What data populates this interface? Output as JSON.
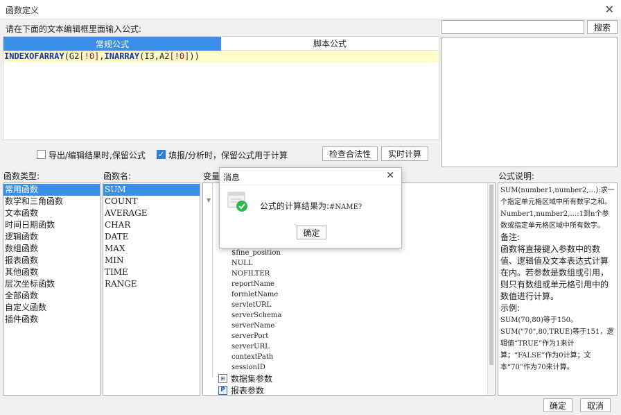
{
  "window": {
    "title": "函数定义",
    "close": "✕"
  },
  "editor": {
    "prompt": "请在下面的文本编辑框里面输入公式:",
    "tabs": [
      "常规公式",
      "脚本公式"
    ],
    "formula_tokens": [
      {
        "t": "INDEXOFARRAY",
        "c": "fn"
      },
      {
        "t": "(G2",
        "c": ""
      },
      {
        "t": "[!0]",
        "c": "br"
      },
      {
        "t": ",",
        "c": ""
      },
      {
        "t": "INARRAY",
        "c": "fn"
      },
      {
        "t": "(I3,A2",
        "c": ""
      },
      {
        "t": "[!0]",
        "c": "br"
      },
      {
        "t": "))",
        "c": ""
      }
    ]
  },
  "search": {
    "value": "",
    "button": "搜索"
  },
  "options": {
    "keep_export": {
      "label": "导出/编辑结果时,保留公式",
      "checked": false
    },
    "keep_fill": {
      "label": "填报/分析时，保留公式用于计算",
      "checked": true
    },
    "check_button": "检查合法性",
    "realtime_button": "实时计算"
  },
  "function_types": {
    "header": "函数类型:",
    "items": [
      "常用函数",
      "数学和三角函数",
      "文本函数",
      "时间日期函数",
      "逻辑函数",
      "数组函数",
      "报表函数",
      "其他函数",
      "层次坐标函数",
      "全部函数",
      "自定义函数",
      "插件函数"
    ],
    "selected": 0
  },
  "function_names": {
    "header": "函数名:",
    "items": [
      "SUM",
      "COUNT",
      "AVERAGE",
      "CHAR",
      "DATE",
      "MAX",
      "MIN",
      "TIME",
      "RANGE"
    ],
    "selected": 0
  },
  "variables": {
    "header": "变量",
    "items": [
      "$fine_position",
      "NULL",
      "NOFILTER",
      "reportName",
      "formletName",
      "servletURL",
      "serverSchema",
      "serverName",
      "serverPort",
      "serverURL",
      "contextPath",
      "sessionID"
    ],
    "group_dataset": "数据集参数",
    "group_report": "报表参数"
  },
  "description": {
    "header": "公式说明:",
    "lines": [
      {
        "t": "SUM(number1,number2,…):求一个指定单元格区域中所有数字之和。",
        "s": true
      },
      {
        "t": "Number1,number2,…:1到n个参数或指定单元格区域中所有数字。",
        "s": true
      },
      {
        "t": "备注:",
        "s": false
      },
      {
        "t": "函数将直接键入参数中的数值、逻辑值及文本表达式计算在内。若参数是数组或引用，则只有数组或单元格引用中的数值进行计算。",
        "s": false
      },
      {
        "t": "示例:",
        "s": false
      },
      {
        "t": "SUM(70,80)等于150。",
        "s": true
      },
      {
        "t": "SUM(\"70\",80,TRUE)等于151，逻辑值“TRUE”作为1来计算；“FALSE”作为0计算；文本“70”作为70来计算。",
        "s": true
      }
    ]
  },
  "footer": {
    "ok": "确定",
    "cancel": "取消"
  },
  "message_box": {
    "title": "消息",
    "close": "✕",
    "text": "公式的计算结果为:",
    "result": "#NAME?",
    "ok": "确定",
    "accent": "#2db84d"
  }
}
